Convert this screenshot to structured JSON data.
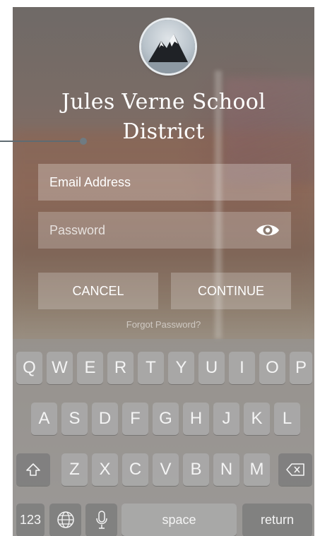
{
  "app": {
    "title_line1": "Jules Verne School",
    "title_line2": "District"
  },
  "form": {
    "email_placeholder": "Email Address",
    "password_placeholder": "Password",
    "cancel_label": "CANCEL",
    "continue_label": "CONTINUE",
    "forgot_label": "Forgot Password?"
  },
  "keyboard": {
    "row1": [
      "Q",
      "W",
      "E",
      "R",
      "T",
      "Y",
      "U",
      "I",
      "O",
      "P"
    ],
    "row2": [
      "A",
      "S",
      "D",
      "F",
      "G",
      "H",
      "J",
      "K",
      "L"
    ],
    "row3": [
      "Z",
      "X",
      "C",
      "V",
      "B",
      "N",
      "M"
    ],
    "numbers_label": "123",
    "space_label": "space",
    "return_label": "return"
  }
}
